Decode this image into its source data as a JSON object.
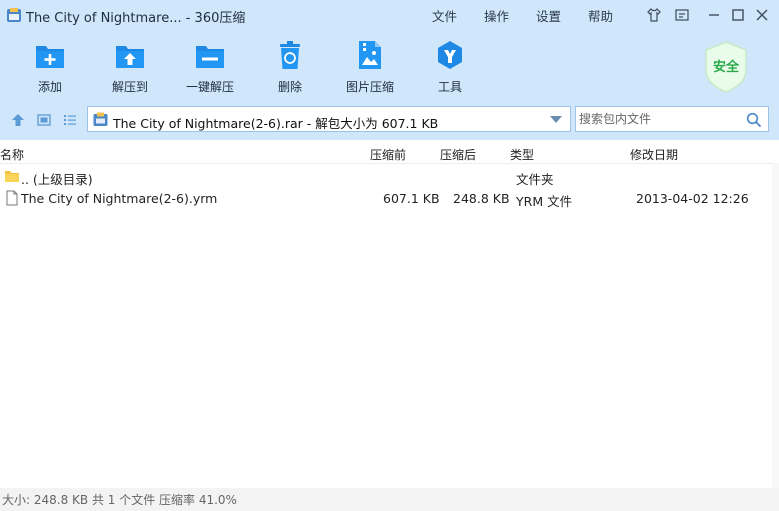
{
  "window": {
    "title": "The City of Nightmare... - 360压缩",
    "menu": [
      "文件",
      "操作",
      "设置",
      "帮助"
    ]
  },
  "toolbar": {
    "buttons": [
      {
        "label": "添加",
        "icon": "add-icon"
      },
      {
        "label": "解压到",
        "icon": "extract-to-icon"
      },
      {
        "label": "一键解压",
        "icon": "one-click-extract-icon"
      },
      {
        "label": "删除",
        "icon": "delete-icon"
      },
      {
        "label": "图片压缩",
        "icon": "image-compress-icon"
      },
      {
        "label": "工具",
        "icon": "tools-icon"
      }
    ],
    "security_badge": "安全"
  },
  "address_bar": {
    "path": "The City of Nightmare(2-6).rar - 解包大小为 607.1 KB",
    "search_placeholder": "搜索包内文件"
  },
  "columns": [
    "名称",
    "压缩前",
    "压缩后",
    "类型",
    "修改日期"
  ],
  "files": [
    {
      "name": ".. (上级目录)",
      "original": "",
      "compressed": "",
      "type": "文件夹",
      "modified": "",
      "icon": "folder-icon"
    },
    {
      "name": "The City of Nightmare(2-6).yrm",
      "original": "607.1 KB",
      "compressed": "248.8 KB",
      "type": "YRM 文件",
      "modified": "2013-04-02 12:26",
      "icon": "file-icon"
    }
  ],
  "status": "大小: 248.8 KB 共 1 个文件 压缩率 41.0%",
  "colors": {
    "chrome": "#cfe6fb",
    "accent": "#1e88e5",
    "safe": "#2aa94d"
  }
}
